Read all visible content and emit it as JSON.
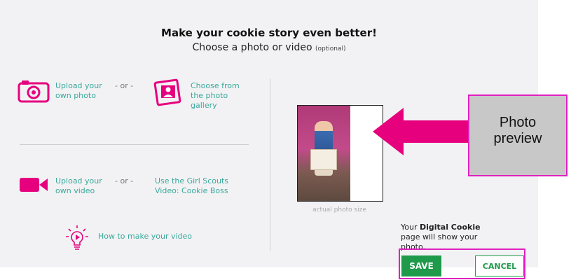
{
  "header": {
    "title": "Make your cookie story even better!",
    "subtitle": "Choose a photo or video",
    "subtitle_optional": "(optional)"
  },
  "photo_options": {
    "upload_label": "Upload your own photo",
    "or": "- or -",
    "gallery_label": "Choose from the photo gallery"
  },
  "video_options": {
    "upload_label": "Upload your own video",
    "or": "- or -",
    "cookie_boss_label": "Use the Girl Scouts Video: Cookie Boss"
  },
  "help": {
    "how_to_label": "How to make your video"
  },
  "preview": {
    "caption": "actual photo size",
    "note_prefix": "Your",
    "note_bold": "Digital Cookie",
    "note_suffix": "page will show your photo."
  },
  "actions": {
    "save": "SAVE",
    "cancel": "CANCEL"
  },
  "annotation": {
    "line1": "Photo",
    "line2": "preview"
  },
  "colors": {
    "accent_pink": "#e6007e",
    "teal": "#3aa99b",
    "green": "#1e9a4a",
    "highlight": "#e020c0"
  },
  "icons": [
    "camera-icon",
    "photo-gallery-icon",
    "video-camera-icon",
    "lightbulb-play-icon",
    "arrow-left-icon"
  ]
}
